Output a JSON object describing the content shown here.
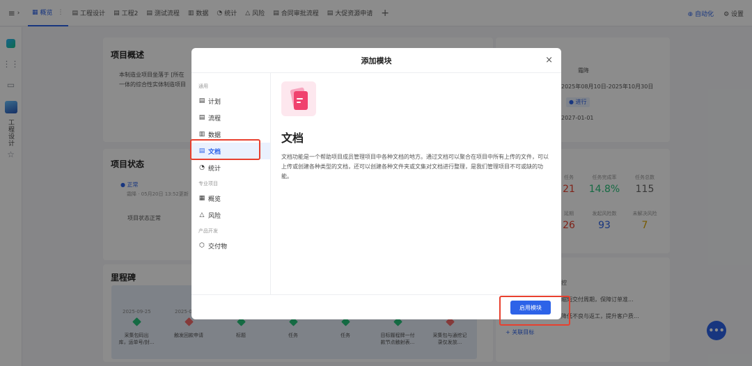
{
  "topbar": {
    "tabs": [
      {
        "icon": "▦",
        "label": "概览",
        "extra": "⋮"
      },
      {
        "icon": "▤",
        "label": "工程设计"
      },
      {
        "icon": "▤",
        "label": "工程2"
      },
      {
        "icon": "▤",
        "label": "测试流程"
      },
      {
        "icon": "▥",
        "label": "数据"
      },
      {
        "icon": "◔",
        "label": "统计"
      },
      {
        "icon": "△",
        "label": "风险"
      },
      {
        "icon": "▤",
        "label": "合同审批流程"
      },
      {
        "icon": "▤",
        "label": "大促资源申请"
      }
    ],
    "add": "+",
    "auto_label": "⊕ 自动化",
    "settings_label": "⚙ 设置"
  },
  "rail": {
    "project_label": "工程设计",
    "star": "☆"
  },
  "background": {
    "overview_title": "项目概述",
    "overview_line1": "本制造业项目坐落于 [所在",
    "overview_line2": "一体的综合性实体制造项目",
    "status_title": "项目状态",
    "status_dot": "● 正常",
    "status_meta": "霜降 · 05月20日 13:52更新",
    "status_text": "项目状态正常",
    "milestone_title": "里程碑",
    "owner": "霜降",
    "period": "2025年08月10日-2025年10月30日",
    "tag": "● 进行",
    "deadline": "2027-01-01",
    "stats": [
      {
        "label": "任务",
        "value": "21",
        "color": "#e8402e"
      },
      {
        "label": "任务完成率",
        "value": "14.8%",
        "color": "#27c27a"
      },
      {
        "label": "任务总数",
        "value": "115",
        "color": "#666666"
      },
      {
        "label": "延期",
        "value": "26",
        "color": "#e8402e"
      },
      {
        "label": "发起风险数",
        "value": "93",
        "color": "#2d63e8"
      },
      {
        "label": "未解决风险",
        "value": "7",
        "color": "#d9a400"
      }
    ],
    "goals": [
      "缩短交付周期，保障订单准...",
      "降低不良与返工，提升客户质..."
    ],
    "goal_prefix": "控",
    "link_goal": "+ 关联目标",
    "milestones": [
      {
        "date": "2025-09-25",
        "label": "采集包码出\n库，运单号/封...",
        "status": "green"
      },
      {
        "date": "2025-0",
        "label": "触发回款申请",
        "status": "red"
      },
      {
        "date": "",
        "label": "标题",
        "status": "green"
      },
      {
        "date": "",
        "label": "任务",
        "status": "green"
      },
      {
        "date": "",
        "label": "任务",
        "status": "green"
      },
      {
        "date": "",
        "label": "目标履程牌一付\n款节点触射表...",
        "status": "green"
      },
      {
        "date": "",
        "label": "采集包与通挖记\n录仅发放...",
        "status": "red"
      }
    ],
    "fab": "•••"
  },
  "modal": {
    "title": "添加模块",
    "close": "×",
    "groups": [
      {
        "name": "通用",
        "items": [
          {
            "icon": "▤",
            "label": "计划"
          },
          {
            "icon": "▤",
            "label": "流程"
          },
          {
            "icon": "▥",
            "label": "数据"
          },
          {
            "icon": "▤",
            "label": "文档",
            "selected": true
          },
          {
            "icon": "◔",
            "label": "统计"
          }
        ]
      },
      {
        "name": "专业项目",
        "items": [
          {
            "icon": "▦",
            "label": "概览"
          },
          {
            "icon": "△",
            "label": "风险"
          }
        ]
      },
      {
        "name": "产品开发",
        "items": [
          {
            "icon": "⬡",
            "label": "交付物"
          }
        ]
      }
    ],
    "module_name": "文档",
    "module_desc": "文档功能是一个帮助项目成员管理项目中各种文档的地方。通过文档可以聚合在项目中所有上传的文件，可以上传或创建各种类型的文档，还可以创建各种文件夹或文集对文档进行整理，是我们管理项目不可或缺的功能。",
    "enable_button": "启用模块"
  }
}
